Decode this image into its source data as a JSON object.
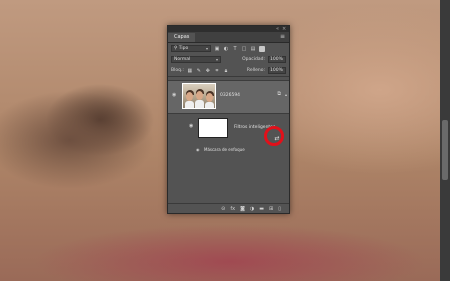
{
  "panel": {
    "tab_label": "Capas",
    "kind_filter": "Tipo",
    "blend_mode": "Normal",
    "opacity_label": "Opacidad:",
    "opacity_value": "100%",
    "lock_label": "Bloq.:",
    "fill_label": "Relleno:",
    "fill_value": "100%"
  },
  "layers": [
    {
      "name": "0326594",
      "sub": "Filtros inteligentes",
      "filter": "Máscara de enfoque"
    }
  ],
  "colors": {
    "highlight_ring": "#e2101a",
    "panel_bg": "#535353"
  }
}
